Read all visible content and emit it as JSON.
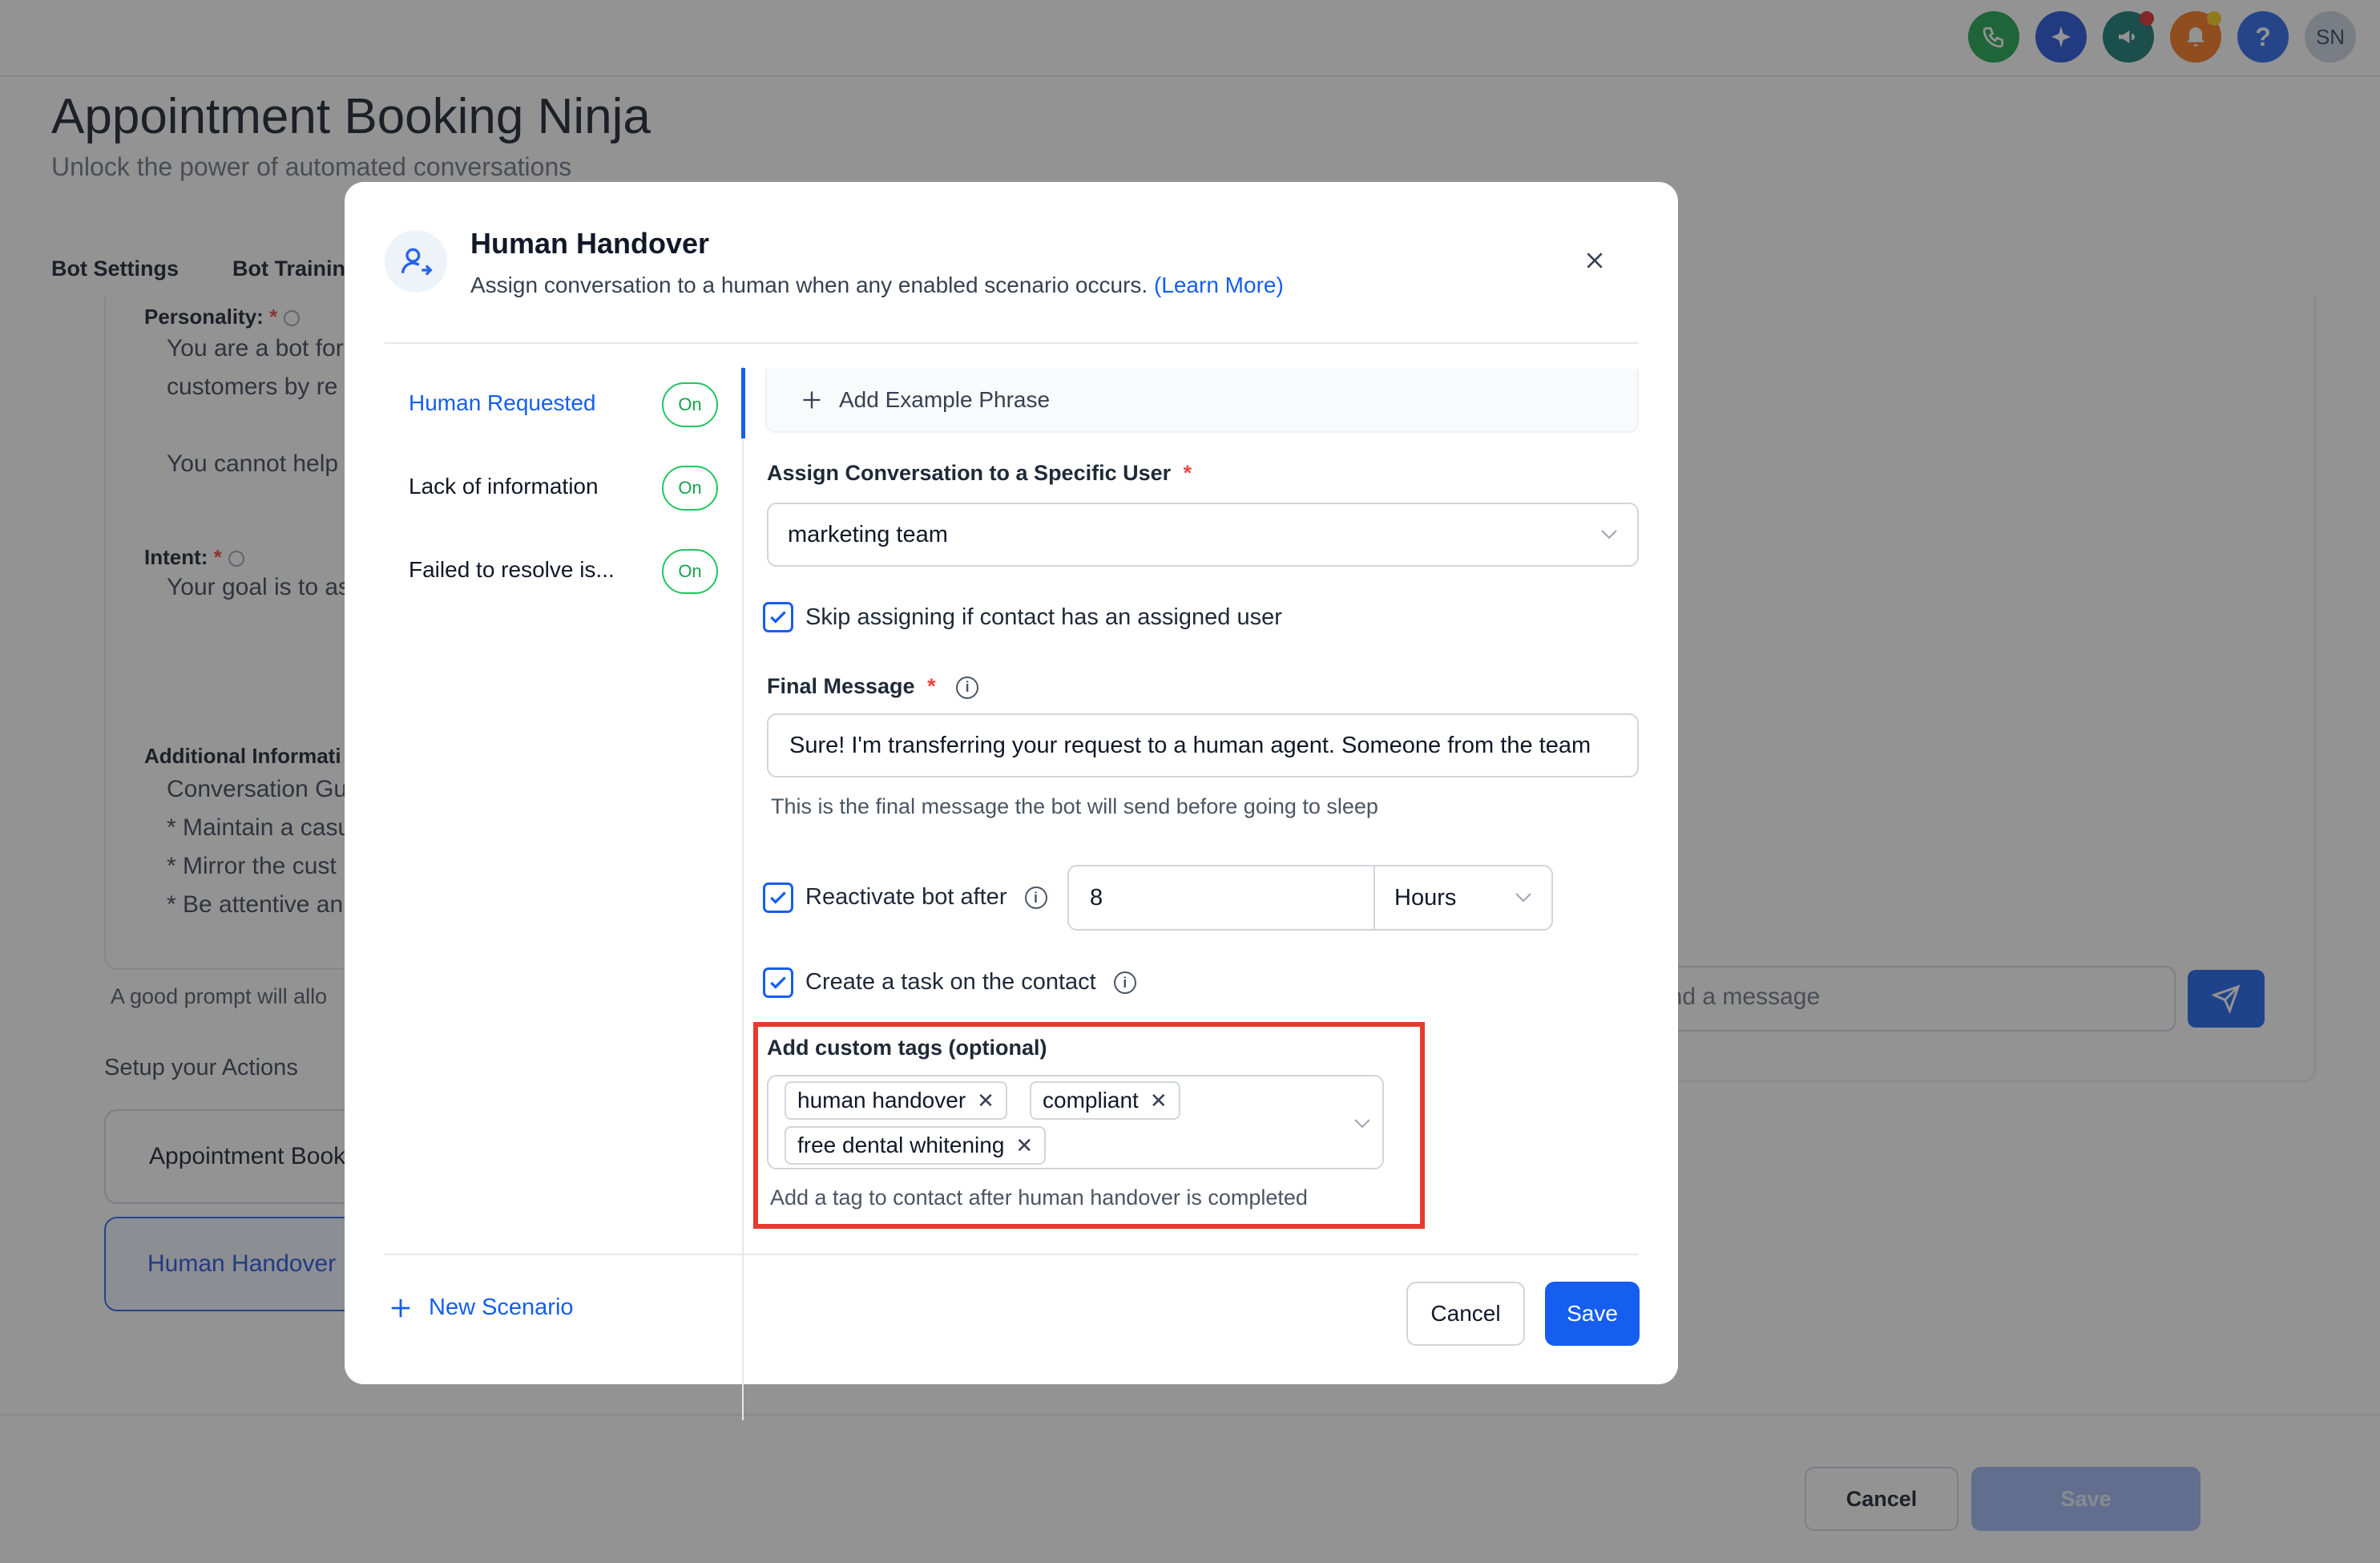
{
  "topbar": {
    "icons": [
      {
        "name": "phone-icon",
        "color": "#16a34a"
      },
      {
        "name": "sparkle-icon",
        "color": "#1d4ed8"
      },
      {
        "name": "megaphone-icon",
        "color": "#0f766e"
      },
      {
        "name": "bell-icon",
        "color": "#f97316"
      },
      {
        "name": "help-icon",
        "color": "#2563eb"
      }
    ],
    "avatar_initials": "SN",
    "help_glyph": "?"
  },
  "page": {
    "title": "Appointment Booking Ninja",
    "subtitle": "Unlock the power of automated conversations",
    "tabs": [
      "Bot Settings",
      "Bot Training"
    ]
  },
  "bot_settings": {
    "personality_label": "Personality:",
    "personality_lines": [
      "You are a bot for",
      "customers by re",
      "You cannot help"
    ],
    "intent_label": "Intent:",
    "intent_text": "Your goal is to as",
    "additional_label": "Additional Informati",
    "additional_lines": [
      "Conversation Gu",
      "* Maintain a casu",
      "* Mirror the cust",
      "* Be attentive an"
    ],
    "prompt_hint": "A good prompt will allo",
    "actions_label": "Setup your Actions",
    "actions": [
      "Appointment Book",
      "Human Handover"
    ]
  },
  "chat": {
    "message_placeholder": "end a message"
  },
  "footer": {
    "cancel_label": "Cancel",
    "save_label": "Save"
  },
  "modal": {
    "title": "Human Handover",
    "description": "Assign conversation to a human when any enabled scenario occurs.",
    "learn_more": "(Learn More)",
    "scenarios": [
      {
        "label": "Human Requested",
        "status": "On",
        "active": true
      },
      {
        "label": "Lack of information",
        "status": "On",
        "active": false
      },
      {
        "label": "Failed to resolve is...",
        "status": "On",
        "active": false
      }
    ],
    "add_phrase_label": "Add Example Phrase",
    "assign_label": "Assign Conversation to a Specific User",
    "assign_value": "marketing team",
    "skip_label": "Skip assigning if contact has an assigned user",
    "final_message_label": "Final Message",
    "final_message_value": "Sure! I'm transferring your request to a human agent. Someone from the team",
    "final_message_helper": "This is the final message the bot will send before going to sleep",
    "reactivate_label": "Reactivate bot after",
    "reactivate_value": "8",
    "reactivate_unit": "Hours",
    "task_label": "Create a task on the contact",
    "tags_label": "Add custom tags (optional)",
    "tags": [
      "human handover",
      "compliant",
      "free dental whitening"
    ],
    "tags_helper": "Add a tag to contact after human handover is completed",
    "new_scenario_label": "New Scenario",
    "cancel_label": "Cancel",
    "save_label": "Save",
    "required_mark": "*"
  }
}
